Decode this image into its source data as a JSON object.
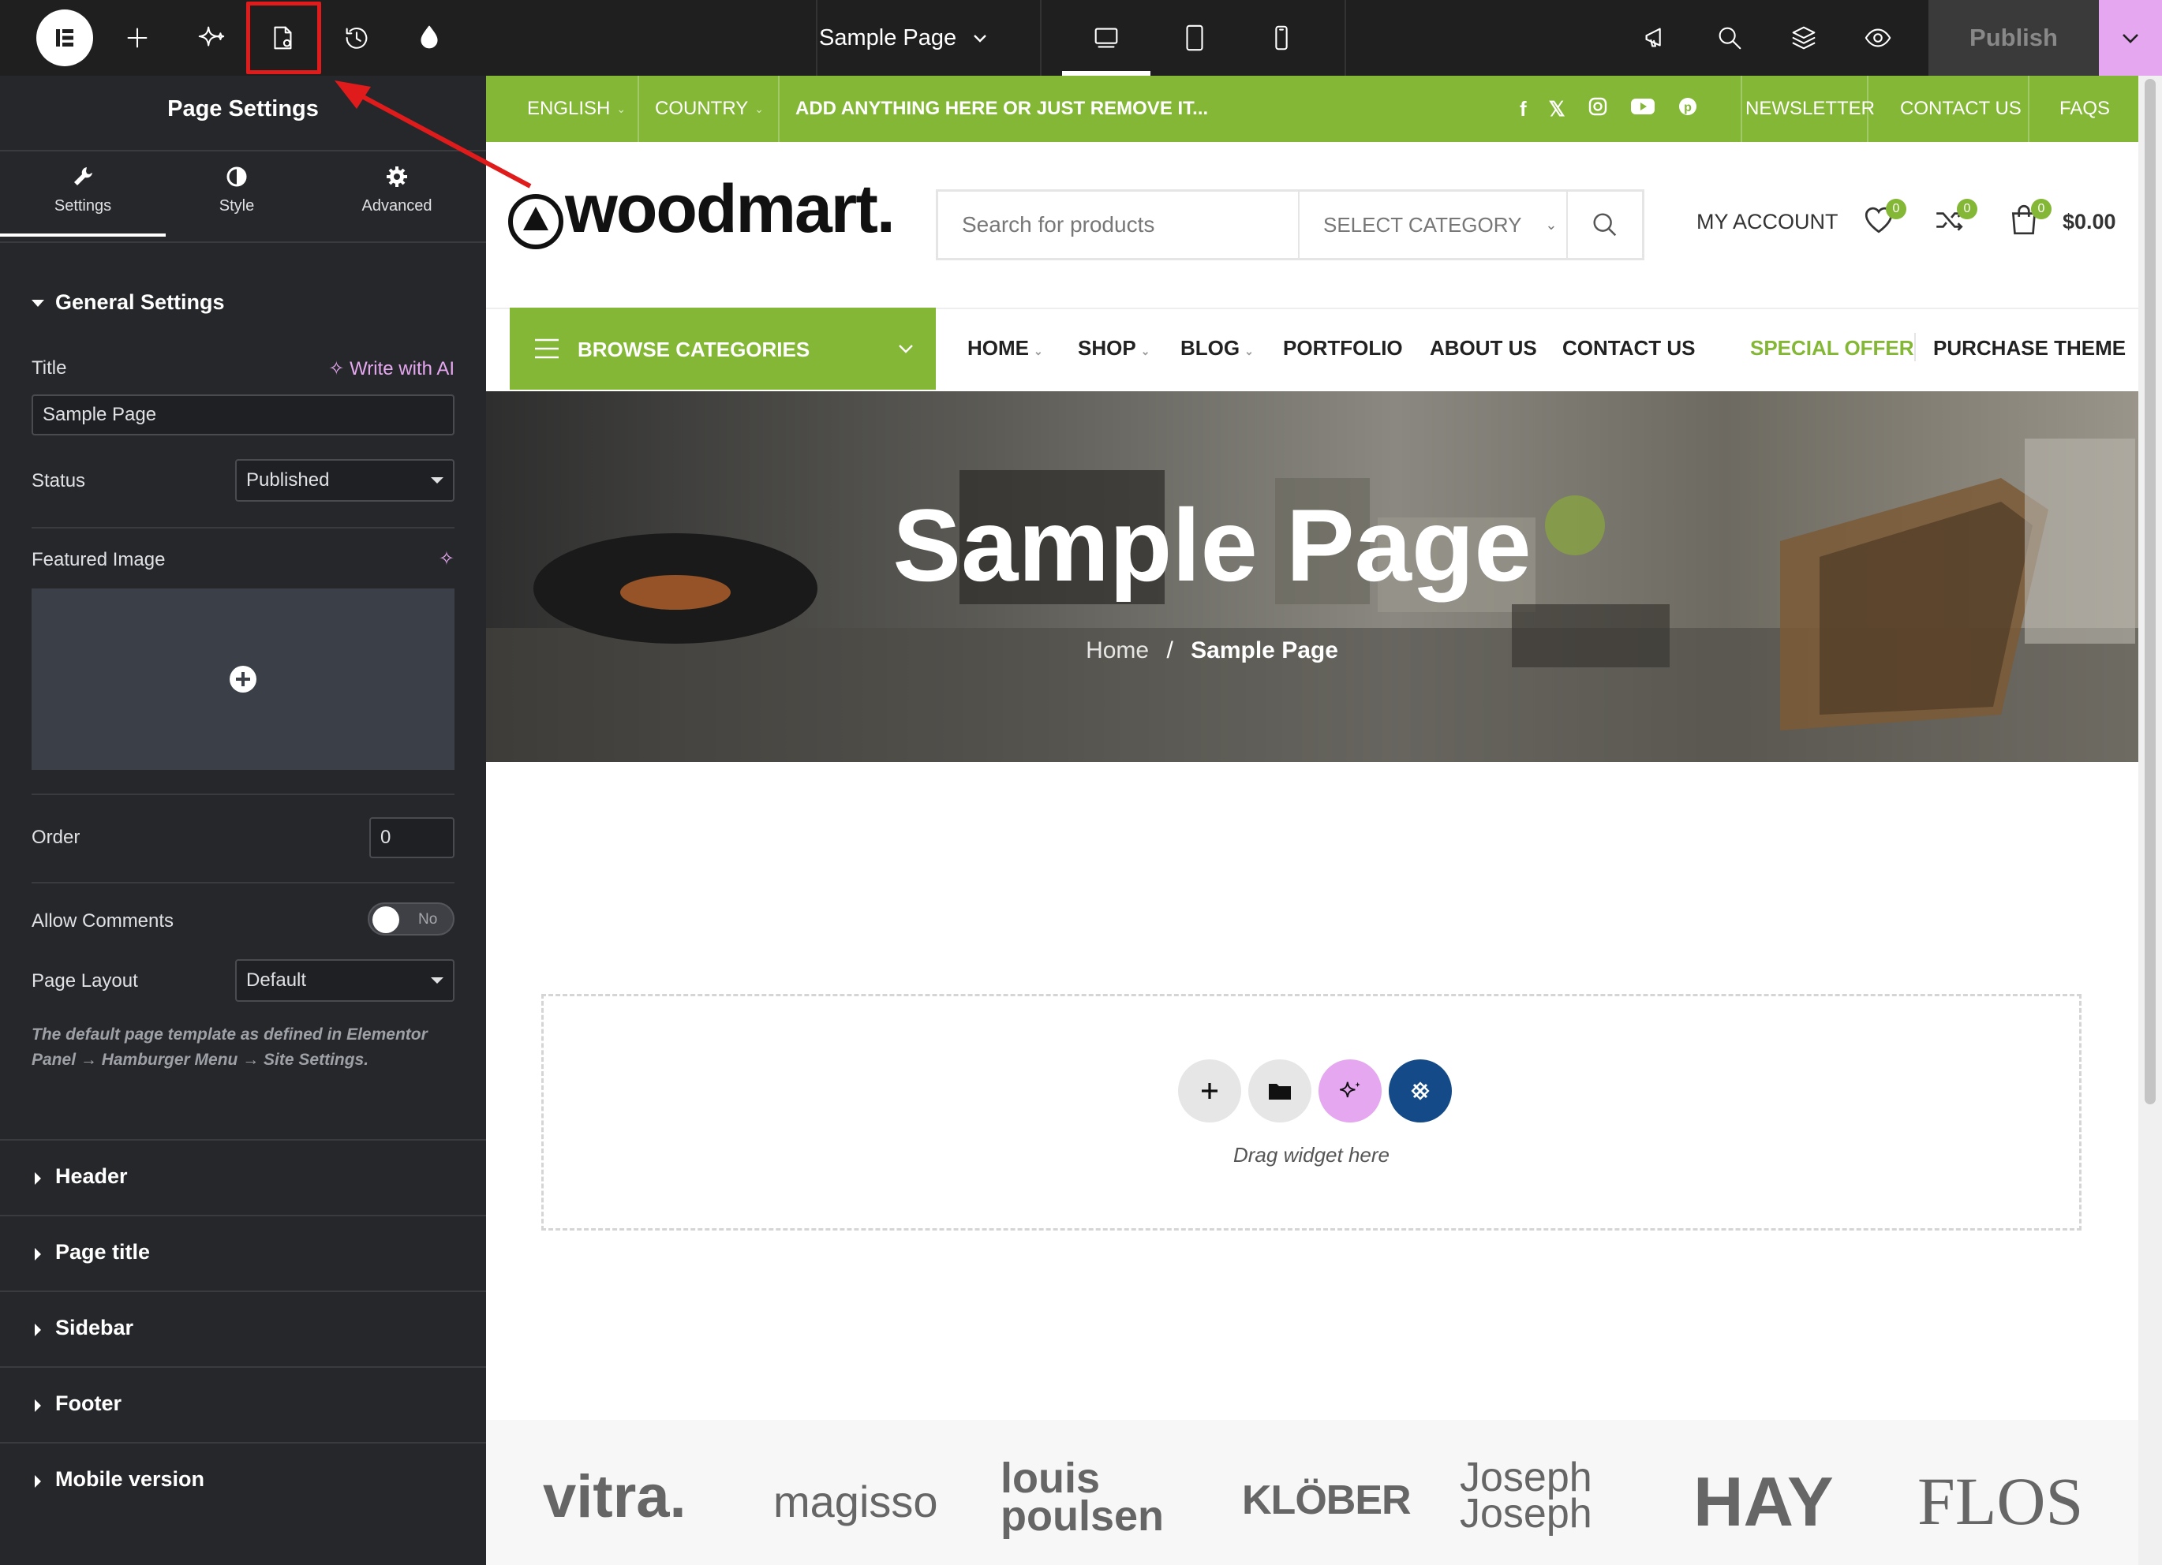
{
  "topbar": {
    "page_name": "Sample Page",
    "publish_label": "Publish",
    "icons": [
      "elementor-logo-icon",
      "add-element-icon",
      "ai-sparkle-icon",
      "page-settings-icon",
      "history-icon",
      "site-settings-icon",
      "desktop-icon",
      "tablet-icon",
      "mobile-icon",
      "notes-icon",
      "search-icon",
      "structure-layers-icon",
      "preview-eye-icon",
      "chevron-down-icon"
    ]
  },
  "panel": {
    "title": "Page Settings",
    "tabs": [
      {
        "label": "Settings"
      },
      {
        "label": "Style"
      },
      {
        "label": "Advanced"
      }
    ],
    "general_settings": "General Settings",
    "title_label": "Title",
    "write_with_ai": "Write with AI",
    "title_value": "Sample Page",
    "status_label": "Status",
    "status_value": "Published",
    "featured_image_label": "Featured Image",
    "order_label": "Order",
    "order_value": "0",
    "allow_comments_label": "Allow Comments",
    "allow_comments_value": "No",
    "page_layout_label": "Page Layout",
    "page_layout_value": "Default",
    "hint": "The default page template as defined in Elementor Panel → Hamburger Menu → Site Settings.",
    "sections": [
      "Header",
      "Page title",
      "Sidebar",
      "Footer",
      "Mobile version"
    ]
  },
  "site": {
    "topbar": {
      "language": "ENGLISH",
      "country": "COUNTRY",
      "promo": "ADD ANYTHING HERE OR JUST REMOVE IT...",
      "links": [
        "NEWSLETTER",
        "CONTACT US",
        "FAQS"
      ]
    },
    "logo": "woodmart.",
    "search_placeholder": "Search for products",
    "select_category": "SELECT CATEGORY",
    "my_account": "MY ACCOUNT",
    "wishlist_count": "0",
    "compare_count": "0",
    "cart_count": "0",
    "cart_total": "$0.00",
    "browse_categories": "BROWSE CATEGORIES",
    "nav": [
      {
        "label": "HOME"
      },
      {
        "label": "SHOP"
      },
      {
        "label": "BLOG"
      },
      {
        "label": "PORTFOLIO"
      },
      {
        "label": "ABOUT US"
      },
      {
        "label": "CONTACT US"
      }
    ],
    "special_offer": "SPECIAL OFFER",
    "purchase_theme": "PURCHASE THEME",
    "hero_title": "Sample Page",
    "breadcrumb_home": "Home",
    "breadcrumb_sep": "/",
    "breadcrumb_current": "Sample Page",
    "drag_widget": "Drag widget here",
    "brands": [
      "vitra.",
      "magisso",
      "louis poulsen",
      "KLÖBER",
      "Joseph Joseph",
      "HAY",
      "FLOS"
    ]
  },
  "colors": {
    "accent_green": "#83b735",
    "editor_dark": "#26272b",
    "ai_pink": "#e5a7ef",
    "highlight_red": "#e01b1b"
  }
}
